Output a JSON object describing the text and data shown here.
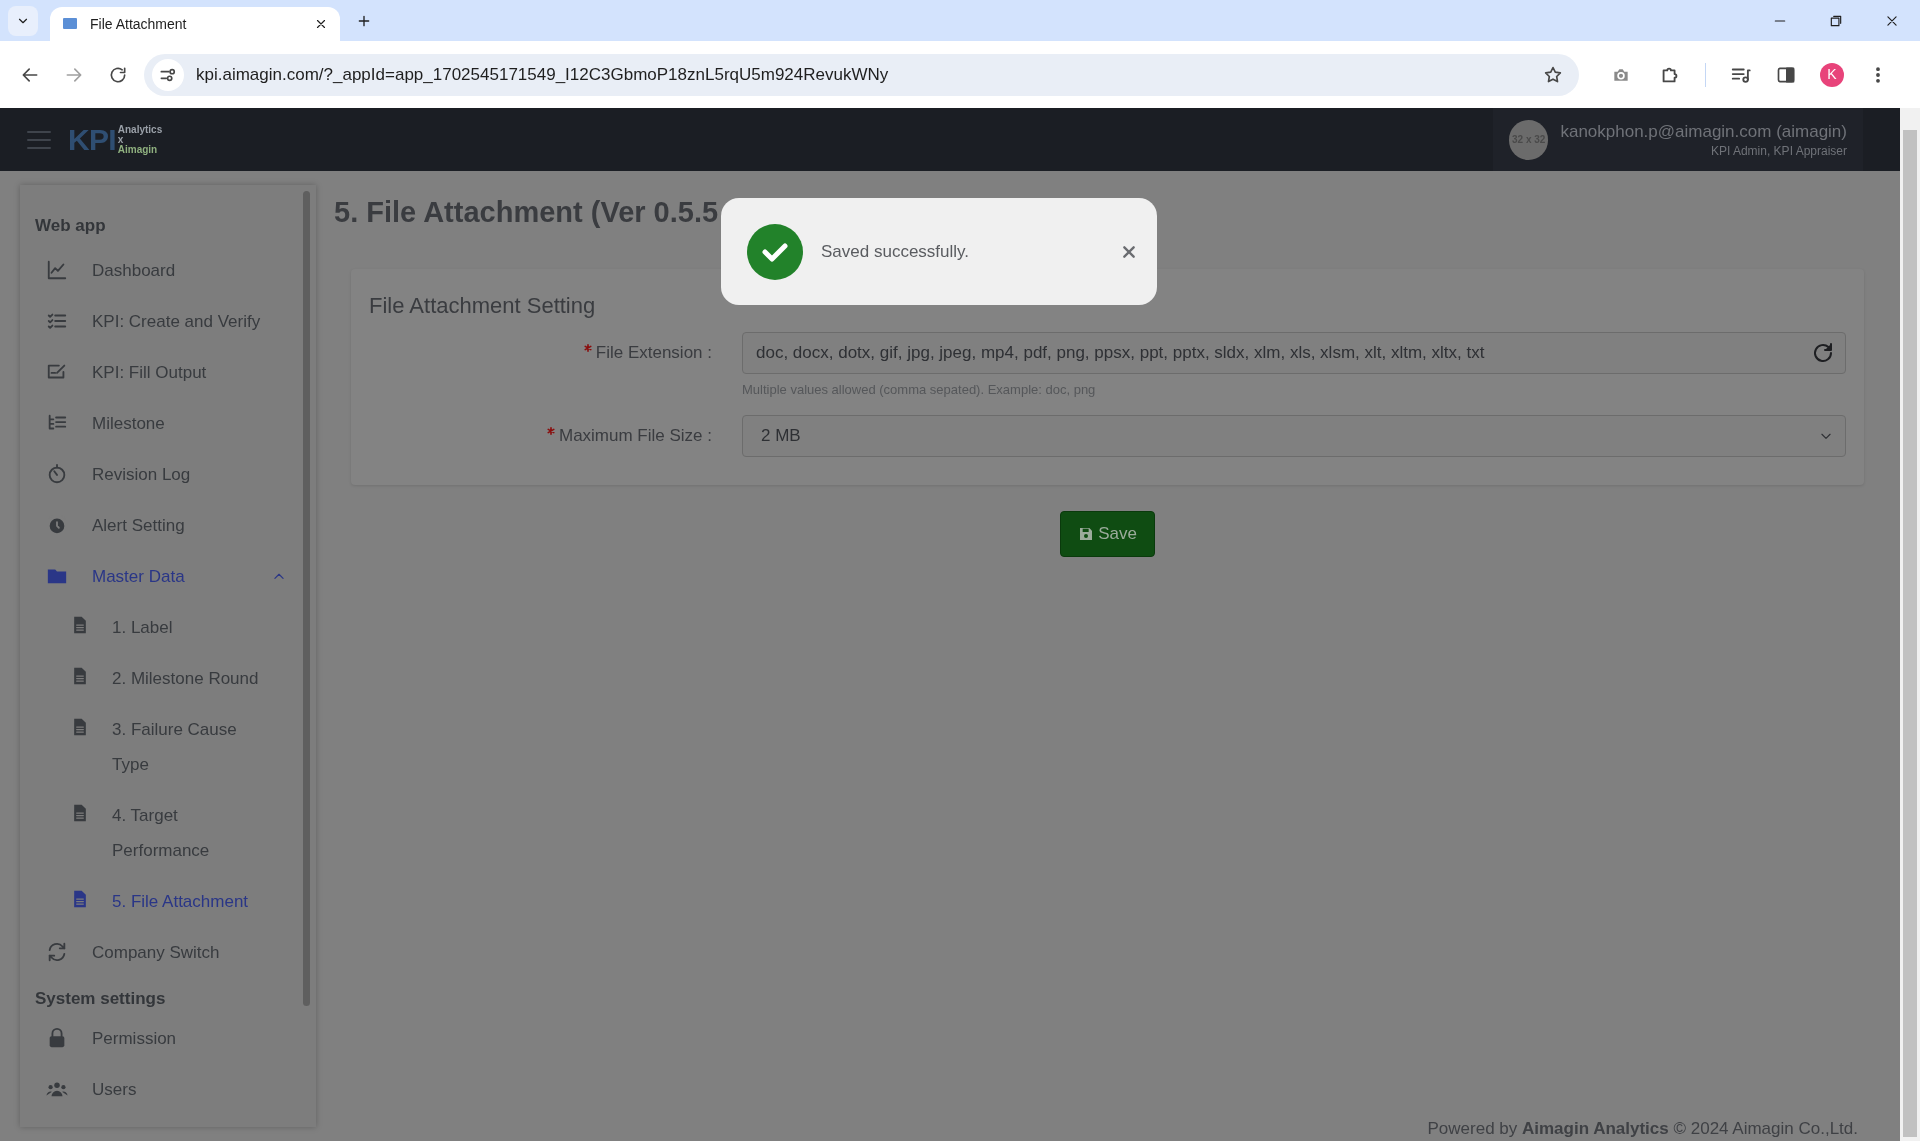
{
  "browser": {
    "tabs": [
      {
        "title": "File Attachment",
        "selected": true
      }
    ],
    "url": "kpi.aimagin.com/?_appId=app_1702545171549_I12C3GbmoP18znL5rqU5m924RevukWNy",
    "profile_initial": "K"
  },
  "header": {
    "logo": {
      "mark": "KPI",
      "lines": [
        "Analytics",
        "x",
        "Aimagin"
      ]
    },
    "avatar_text": "32 x 32",
    "user_name": "kanokphon.p@aimagin.com (aimagin)",
    "user_roles": "KPI Admin, KPI Appraiser"
  },
  "sidebar": {
    "sections": [
      {
        "heading": "Web app",
        "items": [
          {
            "label": "Dashboard",
            "selected": false
          },
          {
            "label": "KPI: Create and Verify",
            "selected": false
          },
          {
            "label": "KPI: Fill Output",
            "selected": false
          },
          {
            "label": "Milestone",
            "selected": false
          },
          {
            "label": "Revision Log",
            "selected": false
          },
          {
            "label": "Alert Setting",
            "selected": false
          },
          {
            "label": "Master Data",
            "selected": true,
            "expanded": true,
            "children": [
              {
                "label": "1. Label",
                "selected": false
              },
              {
                "label": "2. Milestone Round",
                "selected": false
              },
              {
                "label": "3. Failure Cause Type",
                "selected": false
              },
              {
                "label": "4. Target Performance",
                "selected": false
              },
              {
                "label": "5. File Attachment",
                "selected": true
              }
            ]
          },
          {
            "label": "Company Switch",
            "selected": false
          }
        ]
      },
      {
        "heading": "System settings",
        "items": [
          {
            "label": "Permission",
            "selected": false
          },
          {
            "label": "Users",
            "selected": false
          }
        ]
      }
    ]
  },
  "page": {
    "title": "5. File Attachment (Ver 0.5.5",
    "card_title": "File Attachment Setting",
    "fields": [
      {
        "kind": "text",
        "label": "File Extension :",
        "required": true,
        "value": "doc, docx, dotx, gif, jpg, jpeg, mp4, pdf, png, ppsx, ppt, pptx, sldx, xlm, xls, xlsm, xlt, xltm, xltx, txt",
        "hint": "Multiple values allowed (comma sepated). Example: doc, png"
      },
      {
        "kind": "select",
        "label": "Maximum File Size :",
        "required": true,
        "value": "2 MB"
      }
    ],
    "save_button": "Save"
  },
  "toast": {
    "message": "Saved successfully."
  },
  "footer": "Powered by **Aimagin Analytics** © 2024 Aimagin Co.,Ltd."
}
